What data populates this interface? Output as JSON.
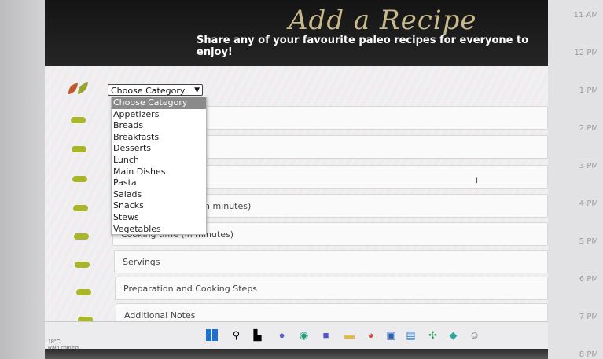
{
  "page": {
    "title": "Add a Recipe",
    "subtitle": "Share any of your favourite paleo recipes for everyone to enjoy!"
  },
  "category_select": {
    "value": "Choose Category",
    "options": [
      "Choose Category",
      "Appetizers",
      "Breads",
      "Breakfasts",
      "Desserts",
      "Lunch",
      "Main Dishes",
      "Pasta",
      "Salads",
      "Snacks",
      "Stews",
      "Vegetables"
    ]
  },
  "form": {
    "prep_time_label": "n minutes)",
    "cooking_time_label": "Cooking time (in minutes)",
    "servings_label": "Servings",
    "steps_label": "Preparation and Cooking Steps",
    "notes_label": "Additional Notes"
  },
  "calendar": {
    "times": [
      "11 AM",
      "12 PM",
      "1 PM",
      "2 PM",
      "3 PM",
      "4 PM",
      "5 PM",
      "6 PM",
      "7 PM",
      "8 PM"
    ]
  },
  "taskbar": {
    "weather_temp": "18°C",
    "weather_desc": "Rain coming"
  },
  "colors": {
    "header_bg": "#1c1c1c",
    "title_color": "#c7b98a",
    "bullet_color": "#a9b62a",
    "dropdown_selected_bg": "#8a8a8a"
  },
  "icons": [
    "leaf-logo-icon",
    "windows-start-icon",
    "search-icon",
    "task-view-icon",
    "chat-icon",
    "edge-icon",
    "teams-icon",
    "file-explorer-icon",
    "chrome-icon",
    "word-icon",
    "store-icon",
    "slack-icon",
    "app-icon",
    "settings-icon"
  ]
}
